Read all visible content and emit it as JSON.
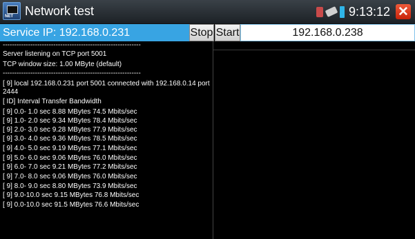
{
  "titlebar": {
    "app_title": "Network test",
    "time": "9:13:12",
    "close_glyph": "✕",
    "app_icon_badge": "NET"
  },
  "controls": {
    "service_ip_label": "Service IP: 192.168.0.231",
    "stop_label": "Stop",
    "start_label": "Start",
    "target_ip_value": "192.168.0.238"
  },
  "log": {
    "separator": "------------------------------------------------------------",
    "lines": [
      "Server listening on TCP port 5001",
      "TCP window size: 1.00 MByte (default)",
      "[  9] local 192.168.0.231 port 5001 connected with 192.168.0.14 port 2444",
      "[ ID] Interval       Transfer     Bandwidth",
      "[  9]  0.0- 1.0 sec  8.88 MBytes  74.5 Mbits/sec",
      "[  9]  1.0- 2.0 sec  9.34 MBytes  78.4 Mbits/sec",
      "[  9]  2.0- 3.0 sec  9.28 MBytes  77.9 Mbits/sec",
      "[  9]  3.0- 4.0 sec  9.36 MBytes  78.5 Mbits/sec",
      "[  9]  4.0- 5.0 sec  9.19 MBytes  77.1 Mbits/sec",
      "[  9]  5.0- 6.0 sec  9.06 MBytes  76.0 Mbits/sec",
      "[  9]  6.0- 7.0 sec  9.21 MBytes  77.2 Mbits/sec",
      "[  9]  7.0- 8.0 sec  9.06 MBytes  76.0 Mbits/sec",
      "[  9]  8.0- 9.0 sec  8.80 MBytes  73.9 Mbits/sec",
      "[  9]  9.0-10.0 sec  9.15 MBytes  76.8 Mbits/sec",
      "[  9]  0.0-10.0 sec  91.5 MBytes  76.6 Mbits/sec"
    ]
  },
  "icons": {
    "app": "network-test-app-icon",
    "sim": "sim-card-icon",
    "usb": "usb-icon",
    "battery": "battery-icon",
    "close": "close-icon"
  },
  "colors": {
    "accent_blue": "#38a4e3",
    "close_red": "#d9331a",
    "battery_blue": "#2fb5e8",
    "background": "#000000"
  }
}
